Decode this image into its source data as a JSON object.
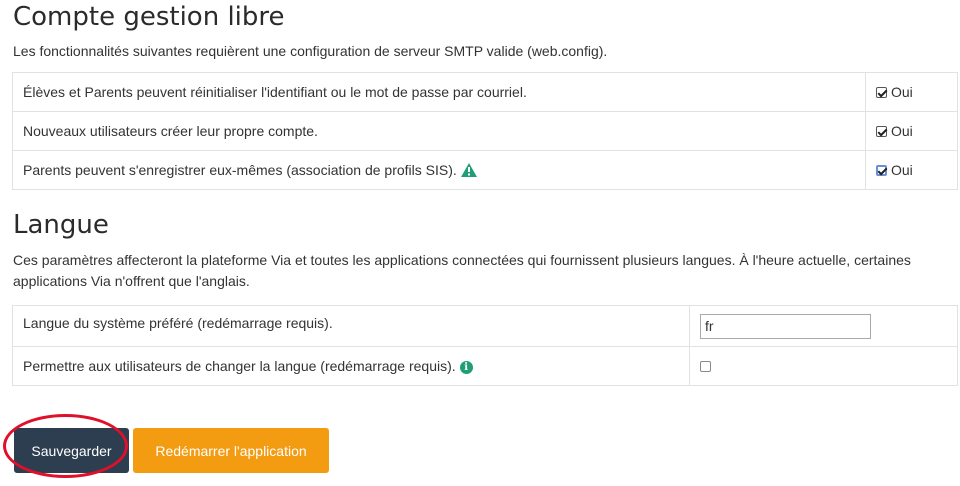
{
  "section_free": {
    "title": "Compte gestion libre",
    "description": "Les fonctionnalités suivantes requièrent une configuration de serveur SMTP valide (web.config).",
    "rows": [
      {
        "label": "Élèves et Parents peuvent réinitialiser l'identifiant ou le mot de passe par courriel.",
        "option": "Oui",
        "checked": true
      },
      {
        "label": "Nouveaux utilisateurs créer leur propre compte.",
        "option": "Oui",
        "checked": true
      },
      {
        "label": "Parents peuvent s'enregistrer eux-mêmes (association de profils SIS).",
        "option": "Oui",
        "checked": true,
        "icon": "warning-icon"
      }
    ]
  },
  "section_lang": {
    "title": "Langue",
    "description": "Ces paramètres affecteront la plateforme Via et toutes les applications connectées qui fournissent plusieurs langues. À l'heure actuelle, certaines applications Via n'offrent que l'anglais.",
    "rows": [
      {
        "label": "Langue du système préféré (redémarrage requis).",
        "value": "fr"
      },
      {
        "label": "Permettre aux utilisateurs de changer la langue (redémarrage requis).",
        "checked": false,
        "icon": "info-icon"
      }
    ]
  },
  "buttons": {
    "save": "Sauvegarder",
    "restart": "Redémarrer l'application"
  },
  "colors": {
    "save_button": "#2d3e50",
    "restart_button": "#f39c12",
    "icon_green": "#1f9e77",
    "annotation_circle": "#e0102a"
  }
}
